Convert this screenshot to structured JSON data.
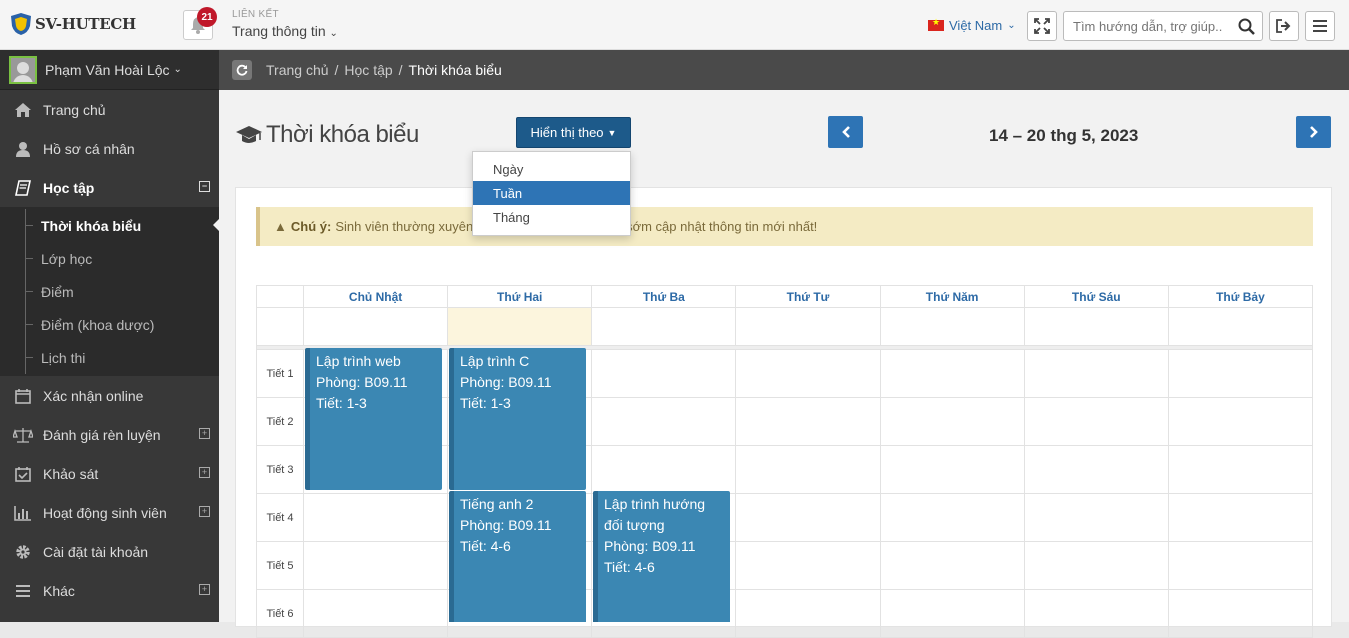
{
  "header": {
    "logo_text": "SV-HUTECH",
    "notification_count": "21",
    "link_label": "LIÊN KẾT",
    "link_value": "Trang thông tin",
    "language": "Việt Nam",
    "search_placeholder": "Tìm hướng dẫn, trợ giúp..."
  },
  "sidebar": {
    "user_name": "Phạm Văn Hoài Lộc",
    "items": [
      {
        "label": "Trang chủ",
        "icon": "home-icon"
      },
      {
        "label": "Hồ sơ cá nhân",
        "icon": "user-icon"
      },
      {
        "label": "Học tập",
        "icon": "book-icon"
      },
      {
        "label": "Xác nhận online",
        "icon": "calendar-icon"
      },
      {
        "label": "Đánh giá rèn luyện",
        "icon": "balance-icon"
      },
      {
        "label": "Khảo sát",
        "icon": "calendar-check-icon"
      },
      {
        "label": "Hoạt động sinh viên",
        "icon": "bar-chart-icon"
      },
      {
        "label": "Cài đặt tài khoản",
        "icon": "gear-icon"
      },
      {
        "label": "Khác",
        "icon": "menu-icon"
      }
    ],
    "subitems": [
      "Thời khóa biểu",
      "Lớp học",
      "Điểm",
      "Điểm (khoa dược)",
      "Lịch thi"
    ]
  },
  "breadcrumb": {
    "items": [
      "Trang chủ",
      "Học tập",
      "Thời khóa biểu"
    ]
  },
  "page": {
    "title": "Thời khóa biểu",
    "view_button": "Hiển thị theo",
    "date_range": "14 – 20 thg 5, 2023",
    "notice_label": "Chú ý:",
    "notice_text_start": "Sinh viên thường xuyên",
    "notice_text_end": "ể sớm cập nhật thông tin mới nhất!"
  },
  "dropdown": {
    "options": [
      "Ngày",
      "Tuần",
      "Tháng"
    ],
    "selected": "Tuần"
  },
  "calendar": {
    "days": [
      "Chủ Nhật",
      "Thứ Hai",
      "Thứ Ba",
      "Thứ Tư",
      "Thứ Năm",
      "Thứ Sáu",
      "Thứ Bảy"
    ],
    "periods": [
      "Tiết 1",
      "Tiết 2",
      "Tiết 3",
      "Tiết 4",
      "Tiết 5",
      "Tiết 6"
    ],
    "events": [
      {
        "title": "Lập trình web",
        "room": "Phòng: B09.11",
        "periods": "Tiết: 1-3"
      },
      {
        "title": "Lập trình C",
        "room": "Phòng: B09.11",
        "periods": "Tiết: 1-3"
      },
      {
        "title": "Tiếng anh 2",
        "room": "Phòng: B09.11",
        "periods": "Tiết: 4-6"
      },
      {
        "title": "Lập trình hướng đối tượng",
        "room": "Phòng: B09.11",
        "periods": "Tiết: 4-6"
      }
    ]
  },
  "colors": {
    "primary": "#2e74b5",
    "event": "#3b87b3",
    "sidebar": "#383838"
  }
}
